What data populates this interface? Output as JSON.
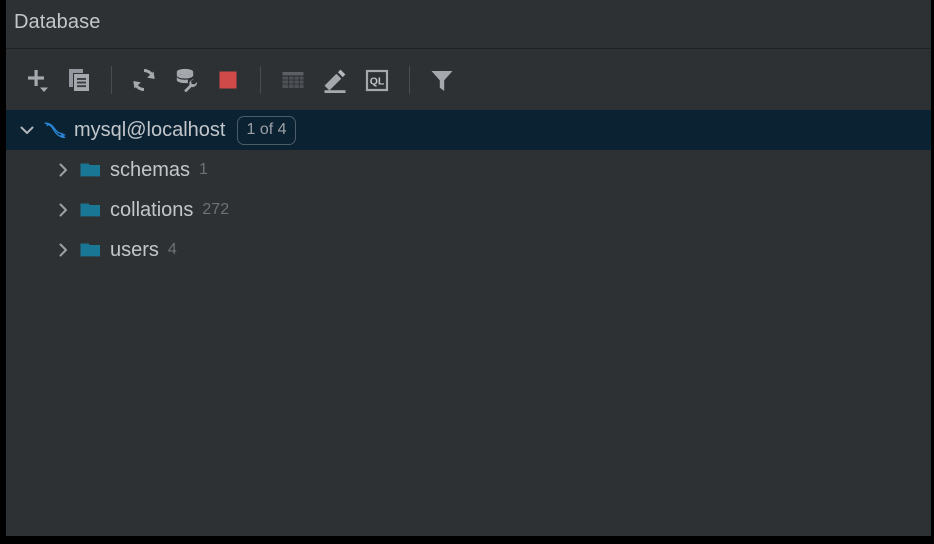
{
  "window": {
    "title": "Database",
    "background": "#2E3134",
    "selection_background": "#0A2232",
    "text_color": "#C3C6CA",
    "muted_text_color": "#6E7276",
    "folder_color": "#1A7695",
    "accent_blue": "#2A87D8",
    "stop_red": "#D04A4A"
  },
  "toolbar": {
    "items": [
      {
        "name": "add-button",
        "icon": "plus-dropdown-icon",
        "tooltip": "New",
        "enabled": true
      },
      {
        "name": "duplicate-button",
        "icon": "copy-icon",
        "tooltip": "Duplicate",
        "enabled": true
      },
      {
        "name": "refresh-button",
        "icon": "refresh-icon",
        "tooltip": "Refresh",
        "enabled": true
      },
      {
        "name": "data-source-properties-button",
        "icon": "database-wrench-icon",
        "tooltip": "Data Source Properties",
        "enabled": true
      },
      {
        "name": "stop-button",
        "icon": "stop-square-icon",
        "tooltip": "Stop",
        "enabled": true
      },
      {
        "name": "table-editor-button",
        "icon": "table-grid-icon",
        "tooltip": "Open Table Editor",
        "enabled": false
      },
      {
        "name": "modify-button",
        "icon": "pencil-icon",
        "tooltip": "Modify",
        "enabled": true
      },
      {
        "name": "query-console-button",
        "icon": "ql-console-icon",
        "tooltip": "Open Query Console",
        "enabled": true
      },
      {
        "name": "filter-button",
        "icon": "funnel-filter-icon",
        "tooltip": "Filter",
        "enabled": true
      }
    ]
  },
  "tree": {
    "root": {
      "label": "mysql@localhost",
      "icon": "mysql-dolphin-icon",
      "expander": "chevron-down-icon",
      "badge": "1 of 4",
      "selected": true,
      "count": ""
    },
    "children": [
      {
        "label": "schemas",
        "count": "1",
        "icon": "folder-icon",
        "expander": "chevron-right-icon"
      },
      {
        "label": "collations",
        "count": "272",
        "icon": "folder-icon",
        "expander": "chevron-right-icon"
      },
      {
        "label": "users",
        "count": "4",
        "icon": "folder-icon",
        "expander": "chevron-right-icon"
      }
    ]
  }
}
